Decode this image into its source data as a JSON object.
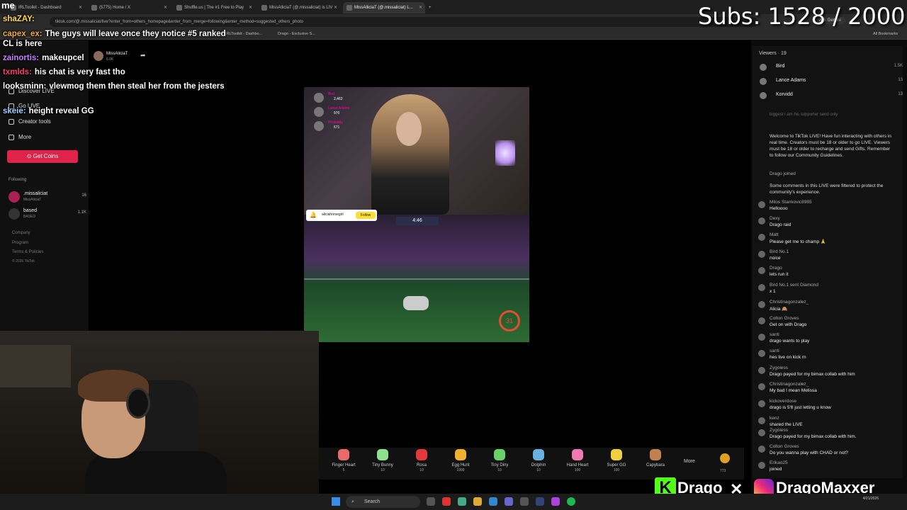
{
  "browser": {
    "tabs": [
      {
        "label": "IRLToolkit - Dashboard",
        "active": false
      },
      {
        "label": "(5775) Home / X",
        "active": false
      },
      {
        "label": "Shuffle.us | The #1 Free to Play",
        "active": false
      },
      {
        "label": "MissAlliciaT (@.missaliciat) is LIV",
        "active": false
      },
      {
        "label": "MissAlliciaT (@.missaliciat) L...",
        "active": true
      }
    ],
    "url": "tiktok.com/@.missaliciat/live?enter_from=others_homepage&enter_from_merge=following&enter_method=suggested_others_photo",
    "ask_gemini": "Ask Gemini",
    "bookmarks": [
      "IRLToolkit - Dashbo...",
      "Drago - Exclusive S..."
    ],
    "all_bookmarks": "All Bookmarks"
  },
  "overlay": {
    "me_label": "me",
    "subs": "Subs: 1528 / 2000",
    "chat": [
      {
        "user": "shaZAY:",
        "color": "#ffd54a",
        "text": ""
      },
      {
        "user": "capex_ex:",
        "color": "#f2a93b",
        "text": "The guys will leave once they notice #5 ranked CL is here"
      },
      {
        "user": "zainortis:",
        "color": "#c77dff",
        "text": "makeupcel"
      },
      {
        "user": "txmlds:",
        "color": "#ff3b6b",
        "text": "his chat is very fast tho"
      },
      {
        "user": "looksminn:",
        "color": "#ffffff",
        "text": "vlewmog them then steal her from the jesters"
      },
      {
        "user": "skeie:",
        "color": "#9ad0ff",
        "text": "height reveal GG"
      }
    ]
  },
  "sidebar": {
    "discover": "Discover LIVE",
    "go_live": "Go LIVE",
    "creator_tools": "Creator tools",
    "more": "More",
    "get_coins": "Get Coins",
    "following_label": "Following",
    "following": [
      {
        "name": ".missaliciat",
        "sub": "MissAliciaT",
        "count": "16"
      },
      {
        "name": "based",
        "sub": "BASED",
        "count": "1.1K"
      }
    ],
    "footer": [
      "Company",
      "Program",
      "Terms & Policies",
      "© 2026 TikTok"
    ]
  },
  "stream": {
    "host_name": "MissAliciaT",
    "host_sub": "6.0K",
    "gift_ranking": [
      {
        "name": "Bird",
        "value": "2,462"
      },
      {
        "name": "Lance Adams",
        "value": "970"
      },
      {
        "name": "Pit.daddy",
        "value": "671"
      }
    ],
    "pinned_user": "aliciahorsegirl",
    "pinned_follow": "Follow",
    "scoreboard": "4:46",
    "boost": "31"
  },
  "gifts": [
    {
      "name": "Finger Heart",
      "value": "5",
      "color": "#e86a6a"
    },
    {
      "name": "Tiny Bunny",
      "value": "10",
      "color": "#8fe08f"
    },
    {
      "name": "Rosa",
      "value": "10",
      "color": "#e23a3a"
    },
    {
      "name": "Egg Hunt",
      "value": "1999",
      "color": "#f0b030"
    },
    {
      "name": "Tiny Diny",
      "value": "10",
      "color": "#6ad06a"
    },
    {
      "name": "Dolphin",
      "value": "10",
      "color": "#6ab0e0"
    },
    {
      "name": "Hand Heart",
      "value": "100",
      "color": "#f07ab0"
    },
    {
      "name": "Super GG",
      "value": "100",
      "color": "#f0d040"
    },
    {
      "name": "Capybara",
      "value": "",
      "color": "#c08050"
    }
  ],
  "gifts_more": "More",
  "gifts_coins": "773",
  "viewers": {
    "title": "Viewers · 19",
    "list": [
      {
        "name": "Bird",
        "count": "1.5K"
      },
      {
        "name": "Lance Adams",
        "count": "13"
      },
      {
        "name": "Korvidd",
        "count": "13"
      }
    ]
  },
  "live_chat": {
    "top_note": "biggest I am his supporter send only",
    "welcome": "Welcome to TikTok LIVE! Have fun interacting with others in real time. Creators must be 18 or older to go LIVE. Viewers must be 18 or older to recharge and send Gifts. Remember to follow our Community Guidelines.",
    "drago_joined": "Drago joined",
    "filtered": "Some comments in this LIVE were filtered to protect the community's experience.",
    "messages": [
      {
        "user": "Milos Stankovic8985",
        "text": "Helloooo"
      },
      {
        "user": "Dexy",
        "text": "Drago raid"
      },
      {
        "user": "Matt",
        "text": "Please get me to champ 🙏"
      },
      {
        "user": "Bird No.1",
        "text": "noice"
      },
      {
        "user": "Drago",
        "text": "lets run it"
      },
      {
        "user": "Bird No.1 sent Diamond",
        "text": "x 1"
      },
      {
        "user": "Christinagonzalez_",
        "text": "Alicia 🙈"
      },
      {
        "user": "Colton Groves",
        "text": "Get on with Drago"
      },
      {
        "user": "santi",
        "text": "drago wants to play"
      },
      {
        "user": "santi",
        "text": "hes live on kick rn"
      },
      {
        "user": "Zygoless",
        "text": "Drago payed for my bimax collab with him"
      },
      {
        "user": "Christinagonzalez_",
        "text": "My bad I mean Melissa"
      },
      {
        "user": "kickoverdose",
        "text": "drago is 5'8 just letting u know"
      },
      {
        "user": "kenz",
        "text": "shared the LIVE"
      },
      {
        "user": "Zygoless",
        "text": "Drago payed for my bimax collab with him."
      },
      {
        "user": "Colton Groves",
        "text": "Do you wanna play with CHAD or not?"
      },
      {
        "user": "Erikao25",
        "text": "joined"
      }
    ]
  },
  "taskbar": {
    "search": "Search",
    "time": "4/21/2026"
  },
  "socials": {
    "kick": "Drago",
    "instagram": "DragoMaxxer"
  }
}
